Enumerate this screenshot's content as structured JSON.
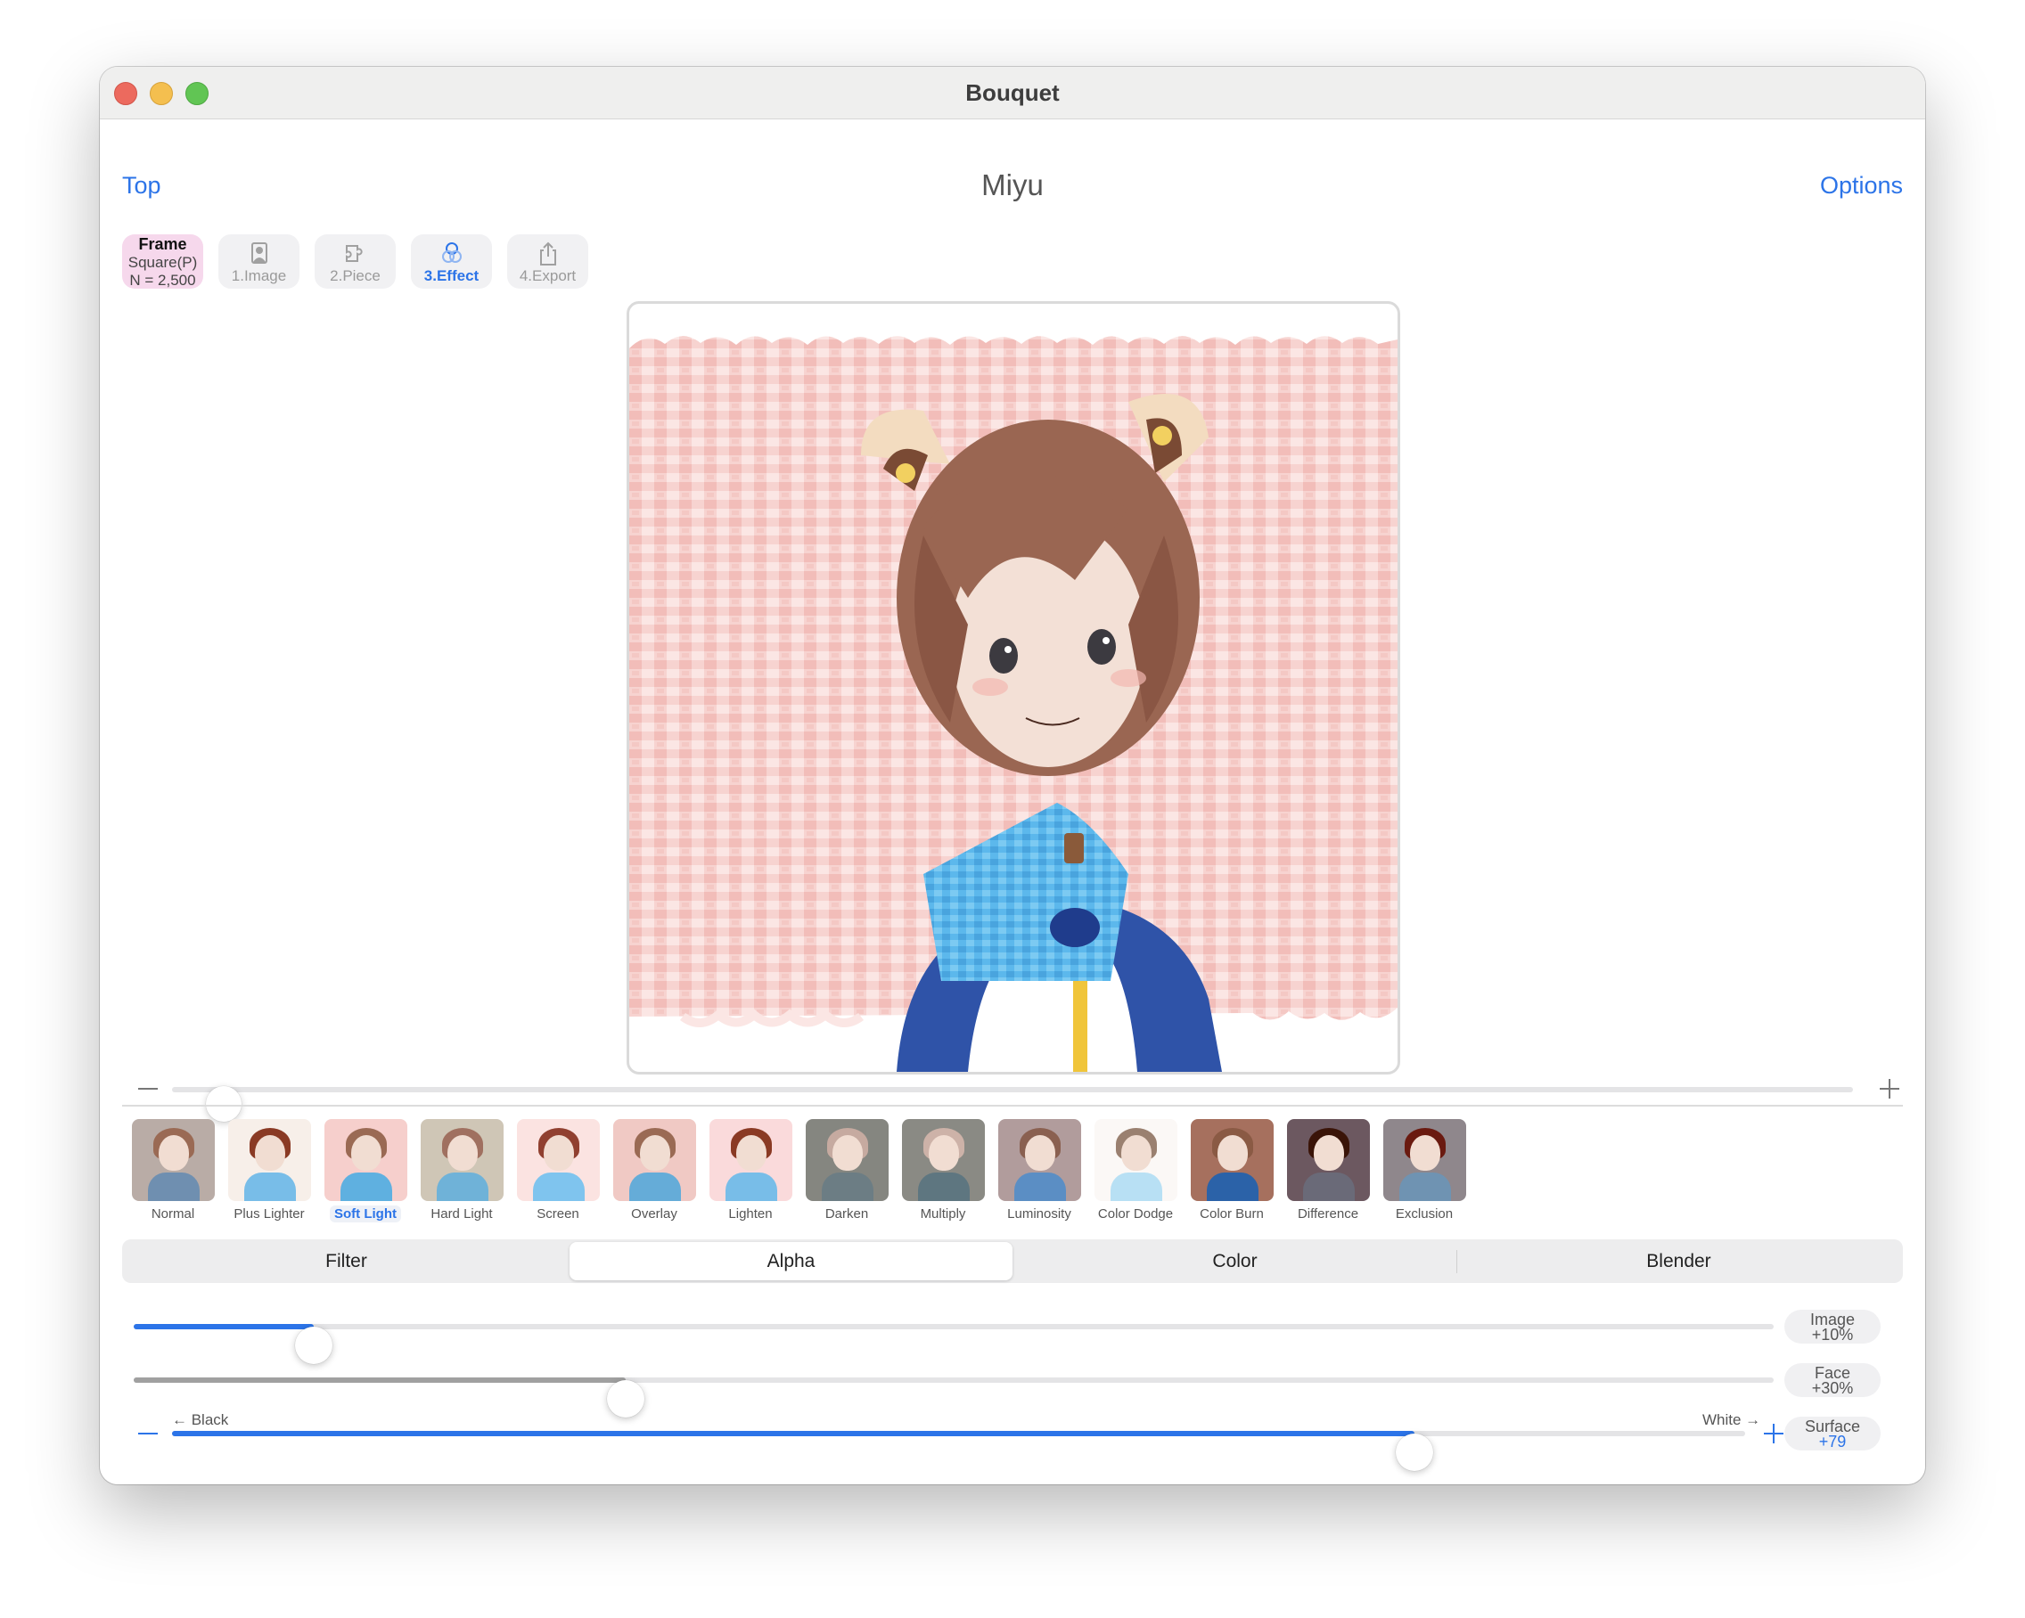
{
  "window": {
    "title": "Bouquet",
    "traffic_lights": [
      "close",
      "minimize",
      "zoom"
    ]
  },
  "nav": {
    "back_label": "Top",
    "title": "Miyu",
    "options_label": "Options"
  },
  "steps": {
    "frame": {
      "title": "Frame",
      "shape": "Square(P)",
      "count": "N = 2,500"
    },
    "items": [
      {
        "label": "1.Image",
        "icon": "person-portrait-icon",
        "active": false
      },
      {
        "label": "2.Piece",
        "icon": "puzzle-piece-icon",
        "active": false
      },
      {
        "label": "3.Effect",
        "icon": "overlapping-circles-icon",
        "active": true
      },
      {
        "label": "4.Export",
        "icon": "share-icon",
        "active": false
      }
    ]
  },
  "preview": {
    "description": "Mosaic artwork of an anime girl with cat ears on pink tiled background"
  },
  "zoom_slider": {
    "value_fraction": 0.02
  },
  "blend_modes": {
    "selected": "Soft Light",
    "items": [
      {
        "label": "Normal",
        "bg": "#b9aca6",
        "hair": "#9a6a54",
        "body": "#6f8fb0"
      },
      {
        "label": "Plus Lighter",
        "bg": "#f7efe9",
        "hair": "#8a3a24",
        "body": "#78bde8"
      },
      {
        "label": "Soft Light",
        "bg": "#f6cfcc",
        "hair": "#9a6a54",
        "body": "#5fb0e0"
      },
      {
        "label": "Hard Light",
        "bg": "#cfc6b6",
        "hair": "#a07060",
        "body": "#6fb2d8"
      },
      {
        "label": "Screen",
        "bg": "#fbe3e1",
        "hair": "#904030",
        "body": "#7fc4ee"
      },
      {
        "label": "Overlay",
        "bg": "#f0c9c4",
        "hair": "#9a6a54",
        "body": "#65acd8"
      },
      {
        "label": "Lighten",
        "bg": "#fadadb",
        "hair": "#8a3a24",
        "body": "#78bde8"
      },
      {
        "label": "Darken",
        "bg": "#858680",
        "hair": "#c6aaa0",
        "body": "#6c7d84"
      },
      {
        "label": "Multiply",
        "bg": "#8a8a84",
        "hair": "#cdb2a8",
        "body": "#5e7680"
      },
      {
        "label": "Luminosity",
        "bg": "#b19c9c",
        "hair": "#8a6050",
        "body": "#5b8ec4"
      },
      {
        "label": "Color Dodge",
        "bg": "#fbf8f6",
        "hair": "#9a8070",
        "body": "#b8e0f4"
      },
      {
        "label": "Color Burn",
        "bg": "#a6705e",
        "hair": "#8a5a44",
        "body": "#2b62a8"
      },
      {
        "label": "Difference",
        "bg": "#6c5860",
        "hair": "#3a1408",
        "body": "#6a6a78"
      },
      {
        "label": "Exclusion",
        "bg": "#8f878c",
        "hair": "#6a1a10",
        "body": "#6f93b2"
      }
    ]
  },
  "tabs": {
    "selected": "Alpha",
    "items": [
      "Filter",
      "Alpha",
      "Color",
      "Blender"
    ]
  },
  "sliders": {
    "image": {
      "badge_title": "Image",
      "badge_value": "+10%",
      "value_fraction": 0.11,
      "fill_color": "#2c74e8"
    },
    "face": {
      "badge_title": "Face",
      "badge_value": "+30%",
      "value_fraction": 0.3,
      "fill_color": "#a0a0a0"
    },
    "surface": {
      "badge_title": "Surface",
      "badge_value": "+79",
      "value_fraction": 0.79,
      "fill_color": "#2c74e8",
      "left_label": "← Black",
      "right_label": "White →"
    }
  },
  "colors": {
    "accent": "#2c74e8",
    "frame_badge_bg": "#f6d8ec",
    "canvas_pink": "#f6cfcc"
  }
}
